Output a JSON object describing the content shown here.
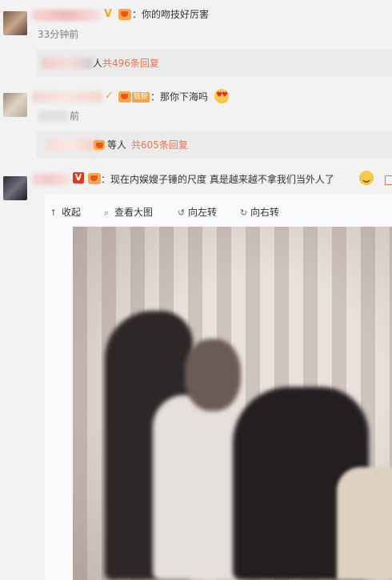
{
  "comments": [
    {
      "text": "：你的吻技好厉害",
      "time": "33分钟前",
      "reply_prefix": "人",
      "reply_link": "共496条回复"
    },
    {
      "fan_badge": "铁粉",
      "text": "：那你下海吗",
      "time": "前",
      "reply_prefix": "等人",
      "reply_link": "共605条回复"
    },
    {
      "text": "：现在内娱嫂子锤的尺度 真是越来越不拿我们当外人了"
    }
  ],
  "toolbar": {
    "collapse": "收起",
    "view_large": "查看大图",
    "rotate_left": "向左转",
    "rotate_right": "向右转"
  },
  "icons": {
    "collapse": "arrow-up-icon",
    "view_large": "search-icon",
    "rotate_left": "rotate-left-icon",
    "rotate_right": "rotate-right-icon"
  },
  "colors": {
    "link": "#eb7350",
    "verified_gold": "#f2a91c",
    "verified_red": "#e0371f",
    "time": "#808080"
  }
}
